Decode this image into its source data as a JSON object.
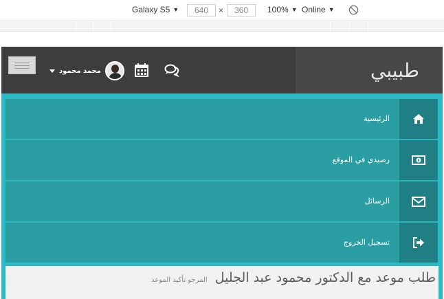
{
  "devtools": {
    "device": "Galaxy S5",
    "width": "640",
    "height": "360",
    "times": "×",
    "zoom": "100%",
    "network": "Online"
  },
  "header": {
    "brand": "طبيبي",
    "user_name": "محمد محمود"
  },
  "menu": {
    "items": [
      {
        "label": "الرئيسية",
        "icon": "home-icon"
      },
      {
        "label": "رصيدي في الموقع",
        "icon": "money-icon"
      },
      {
        "label": "الرسائل",
        "icon": "envelope-icon"
      },
      {
        "label": "تسجيل الخروج",
        "icon": "sign-out-icon"
      }
    ]
  },
  "content": {
    "title": "طلب موعد مع الدكتور محمود عبد الجليل",
    "subtitle": "المرجو تأكيد الموعد"
  },
  "colors": {
    "header": "#3d3d3d",
    "brand_bg": "#474747",
    "accent": "#2cbac4",
    "menu_row": "#2a9ea3",
    "menu_icon_bg": "#207f84"
  }
}
